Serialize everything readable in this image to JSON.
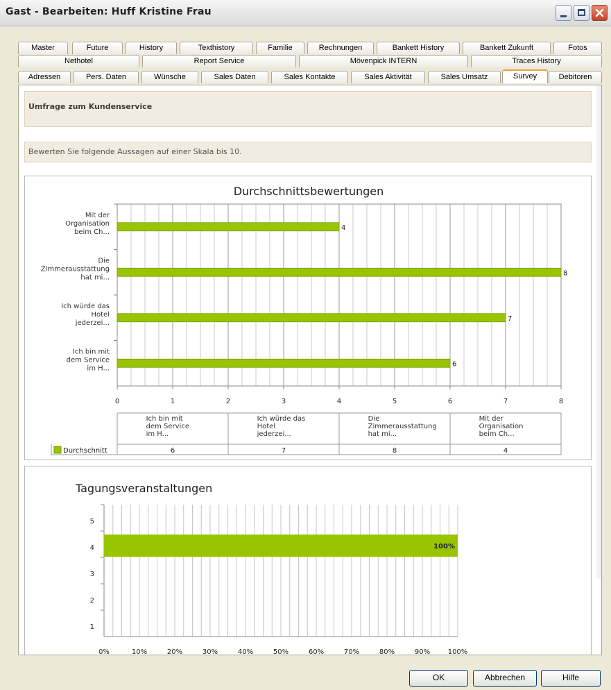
{
  "window": {
    "title": "Gast - Bearbeiten: Huff Kristine Frau"
  },
  "tabs": {
    "row1": [
      "Master",
      "Future",
      "History",
      "Texthistory",
      "Familie",
      "Rechnungen",
      "Bankett History",
      "Bankett Zukunft",
      "Fotos"
    ],
    "row2": [
      "Nethotel",
      "Report Service",
      "Mövenpick INTERN",
      "Traces History"
    ],
    "row3": [
      "Adressen",
      "Pers. Daten",
      "Wünsche",
      "Sales Daten",
      "Sales Kontakte",
      "Sales Aktivität",
      "Sales Umsatz",
      "Survey",
      "Debitoren"
    ],
    "active": "Survey"
  },
  "survey": {
    "heading": "Umfrage zum Kundenservice",
    "instruction": "Bewerten Sie folgende Aussagen auf einer Skala bis 10."
  },
  "chart_data": [
    {
      "type": "bar",
      "orientation": "horizontal",
      "title": "Durchschnittsbewertungen",
      "categories": [
        "Mit der Organisation beim Ch...",
        "Die Zimmerausstattung hat mi...",
        "Ich würde das Hotel jederzei...",
        "Ich bin mit dem Service im H..."
      ],
      "category_lines": [
        [
          "Mit der",
          "Organisation",
          "beim Ch..."
        ],
        [
          "Die",
          "Zimmerausstattung",
          "hat mi..."
        ],
        [
          "Ich würde das",
          "Hotel",
          "jederzei..."
        ],
        [
          "Ich bin mit",
          "dem Service",
          "im H..."
        ]
      ],
      "series": [
        {
          "name": "Durchschnitt",
          "values": [
            4,
            8,
            7,
            6
          ],
          "color": "#99c400"
        }
      ],
      "xlim": [
        0,
        8
      ],
      "xticks": [
        "0",
        "1",
        "2",
        "3",
        "4",
        "5",
        "6",
        "7",
        "8"
      ],
      "grid": true,
      "data_table": {
        "columns": [
          [
            "Ich bin mit",
            "dem Service",
            "im H..."
          ],
          [
            "Ich würde das",
            "Hotel",
            "jederzei..."
          ],
          [
            "Die",
            "Zimmerausstattung",
            "hat mi..."
          ],
          [
            "Mit der",
            "Organisation",
            "beim Ch..."
          ]
        ],
        "row_label": "Durchschnitt",
        "values": [
          "6",
          "7",
          "8",
          "4"
        ]
      }
    },
    {
      "type": "bar",
      "orientation": "horizontal",
      "title": "Tagungsveranstaltungen",
      "categories": [
        "5",
        "4",
        "3",
        "2",
        "1"
      ],
      "series": [
        {
          "values": [
            0,
            100,
            0,
            0,
            0
          ],
          "color": "#99c400"
        }
      ],
      "value_label": "100%",
      "xlim": [
        0,
        100
      ],
      "xticks": [
        "0%",
        "10%",
        "20%",
        "30%",
        "40%",
        "50%",
        "60%",
        "70%",
        "80%",
        "90%",
        "100%"
      ],
      "grid": true
    }
  ],
  "buttons": {
    "ok": "OK",
    "cancel": "Abbrechen",
    "help": "Hilfe"
  },
  "colors": {
    "bar": "#99c400",
    "active_tab_accent": "#e8a33d",
    "info_background": "#f1ecdf"
  }
}
